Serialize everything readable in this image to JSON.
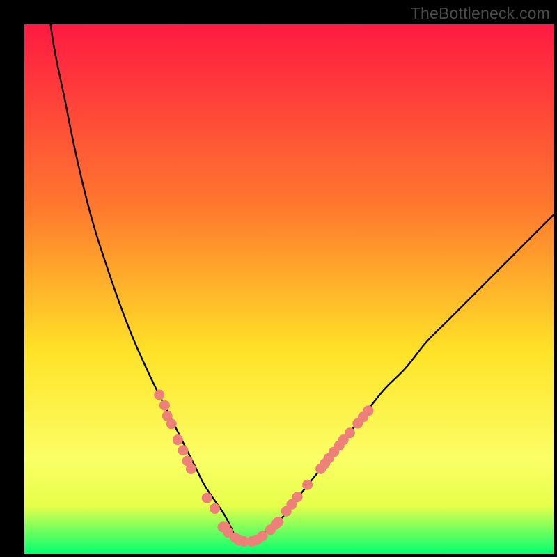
{
  "watermark": "TheBottleneck.com",
  "colors": {
    "gradient_top": "#ff1a42",
    "gradient_mid_upper": "#ff7a2e",
    "gradient_mid": "#ffe328",
    "gradient_lower_band": "#fbff66",
    "gradient_bottom": "#05ff70",
    "curve_stroke": "#000000",
    "marker_fill": "#ed8079",
    "marker_stroke": "#d76a63",
    "frame_bg": "#000000"
  },
  "chart_data": {
    "type": "line",
    "title": "",
    "xlabel": "",
    "ylabel": "",
    "xlim": [
      0,
      100
    ],
    "ylim": [
      0,
      100
    ],
    "annotations": [
      "TheBottleneck.com"
    ],
    "legend": [],
    "grid": false,
    "series": [
      {
        "name": "bottleneck-curve",
        "x": [
          0,
          4,
          8,
          12,
          16,
          20,
          24,
          28,
          30,
          32,
          34,
          36,
          38,
          40,
          41,
          42,
          44,
          48,
          52,
          56,
          60,
          64,
          68,
          72,
          76,
          80,
          84,
          88,
          92,
          96,
          100
        ],
        "y": [
          162,
          108,
          84,
          66,
          53,
          42,
          33,
          25,
          21,
          17,
          13,
          10,
          7,
          3,
          2,
          2,
          3,
          6,
          11,
          16,
          21,
          26,
          31,
          35,
          40,
          44,
          48,
          52,
          56,
          60,
          64
        ]
      }
    ],
    "markers": [
      {
        "x": 25.5,
        "y": 30
      },
      {
        "x": 26.5,
        "y": 28
      },
      {
        "x": 27.0,
        "y": 26
      },
      {
        "x": 27.8,
        "y": 24.5
      },
      {
        "x": 29.0,
        "y": 21.5
      },
      {
        "x": 30.0,
        "y": 19.5
      },
      {
        "x": 30.8,
        "y": 17.5
      },
      {
        "x": 31.5,
        "y": 16
      },
      {
        "x": 34.5,
        "y": 10.5
      },
      {
        "x": 36.0,
        "y": 8.5
      },
      {
        "x": 37.5,
        "y": 5.0
      },
      {
        "x": 38.0,
        "y": 5.0
      },
      {
        "x": 38.5,
        "y": 4.0
      },
      {
        "x": 39.8,
        "y": 3.0
      },
      {
        "x": 40.5,
        "y": 2.5
      },
      {
        "x": 41.5,
        "y": 2.3
      },
      {
        "x": 43.0,
        "y": 2.3
      },
      {
        "x": 44.0,
        "y": 2.6
      },
      {
        "x": 45.0,
        "y": 3.3
      },
      {
        "x": 46.5,
        "y": 4.5
      },
      {
        "x": 47.5,
        "y": 5.5
      },
      {
        "x": 48.0,
        "y": 6.0
      },
      {
        "x": 49.5,
        "y": 8.0
      },
      {
        "x": 50.5,
        "y": 9.3
      },
      {
        "x": 51.6,
        "y": 10.7
      },
      {
        "x": 53.5,
        "y": 13.0
      },
      {
        "x": 56.0,
        "y": 16.0
      },
      {
        "x": 56.8,
        "y": 17.0
      },
      {
        "x": 57.5,
        "y": 18.0
      },
      {
        "x": 58.5,
        "y": 19.2
      },
      {
        "x": 59.5,
        "y": 20.4
      },
      {
        "x": 60.3,
        "y": 21.5
      },
      {
        "x": 61.5,
        "y": 22.8
      },
      {
        "x": 63.0,
        "y": 24.6
      },
      {
        "x": 64.0,
        "y": 25.8
      },
      {
        "x": 65.0,
        "y": 27.0
      }
    ]
  }
}
